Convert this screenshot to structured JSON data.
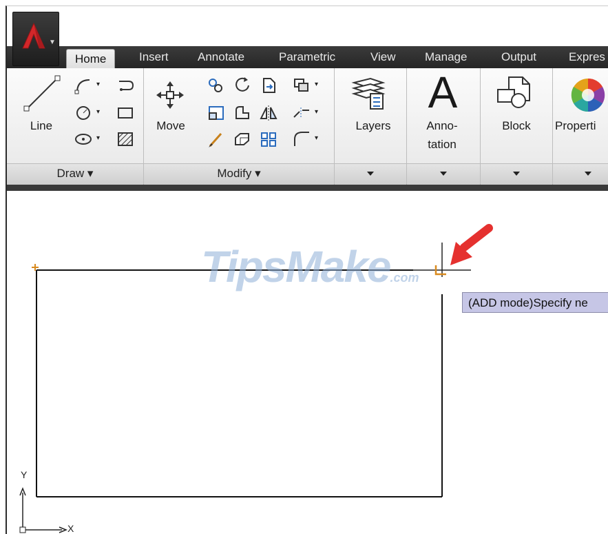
{
  "ribbon": {
    "tabs": [
      "Home",
      "Insert",
      "Annotate",
      "Parametric",
      "View",
      "Manage",
      "Output",
      "Expres"
    ],
    "draw": {
      "line_label": "Line",
      "panel_label": "Draw ▾"
    },
    "modify": {
      "move_label": "Move",
      "panel_label": "Modify ▾"
    },
    "layers_label": "Layers",
    "annotation_label_1": "Anno-",
    "annotation_label_2": "tation",
    "annotation_glyph": "A",
    "block_label": "Block",
    "properties_label": "Properti"
  },
  "canvas": {
    "watermark": "TipsMake",
    "watermark_suffix": ".com",
    "tooltip": "(ADD mode)Specify ne",
    "ucs_y": "Y",
    "ucs_x": "X"
  },
  "colors": {
    "ribbon_bg": "#ececec",
    "tab_bar": "#2f2f2f",
    "tooltip_bg": "#c6c6e6",
    "marker": "#d98a1e",
    "arrow": "#e5312f",
    "watermark": "#8fb0d8"
  }
}
